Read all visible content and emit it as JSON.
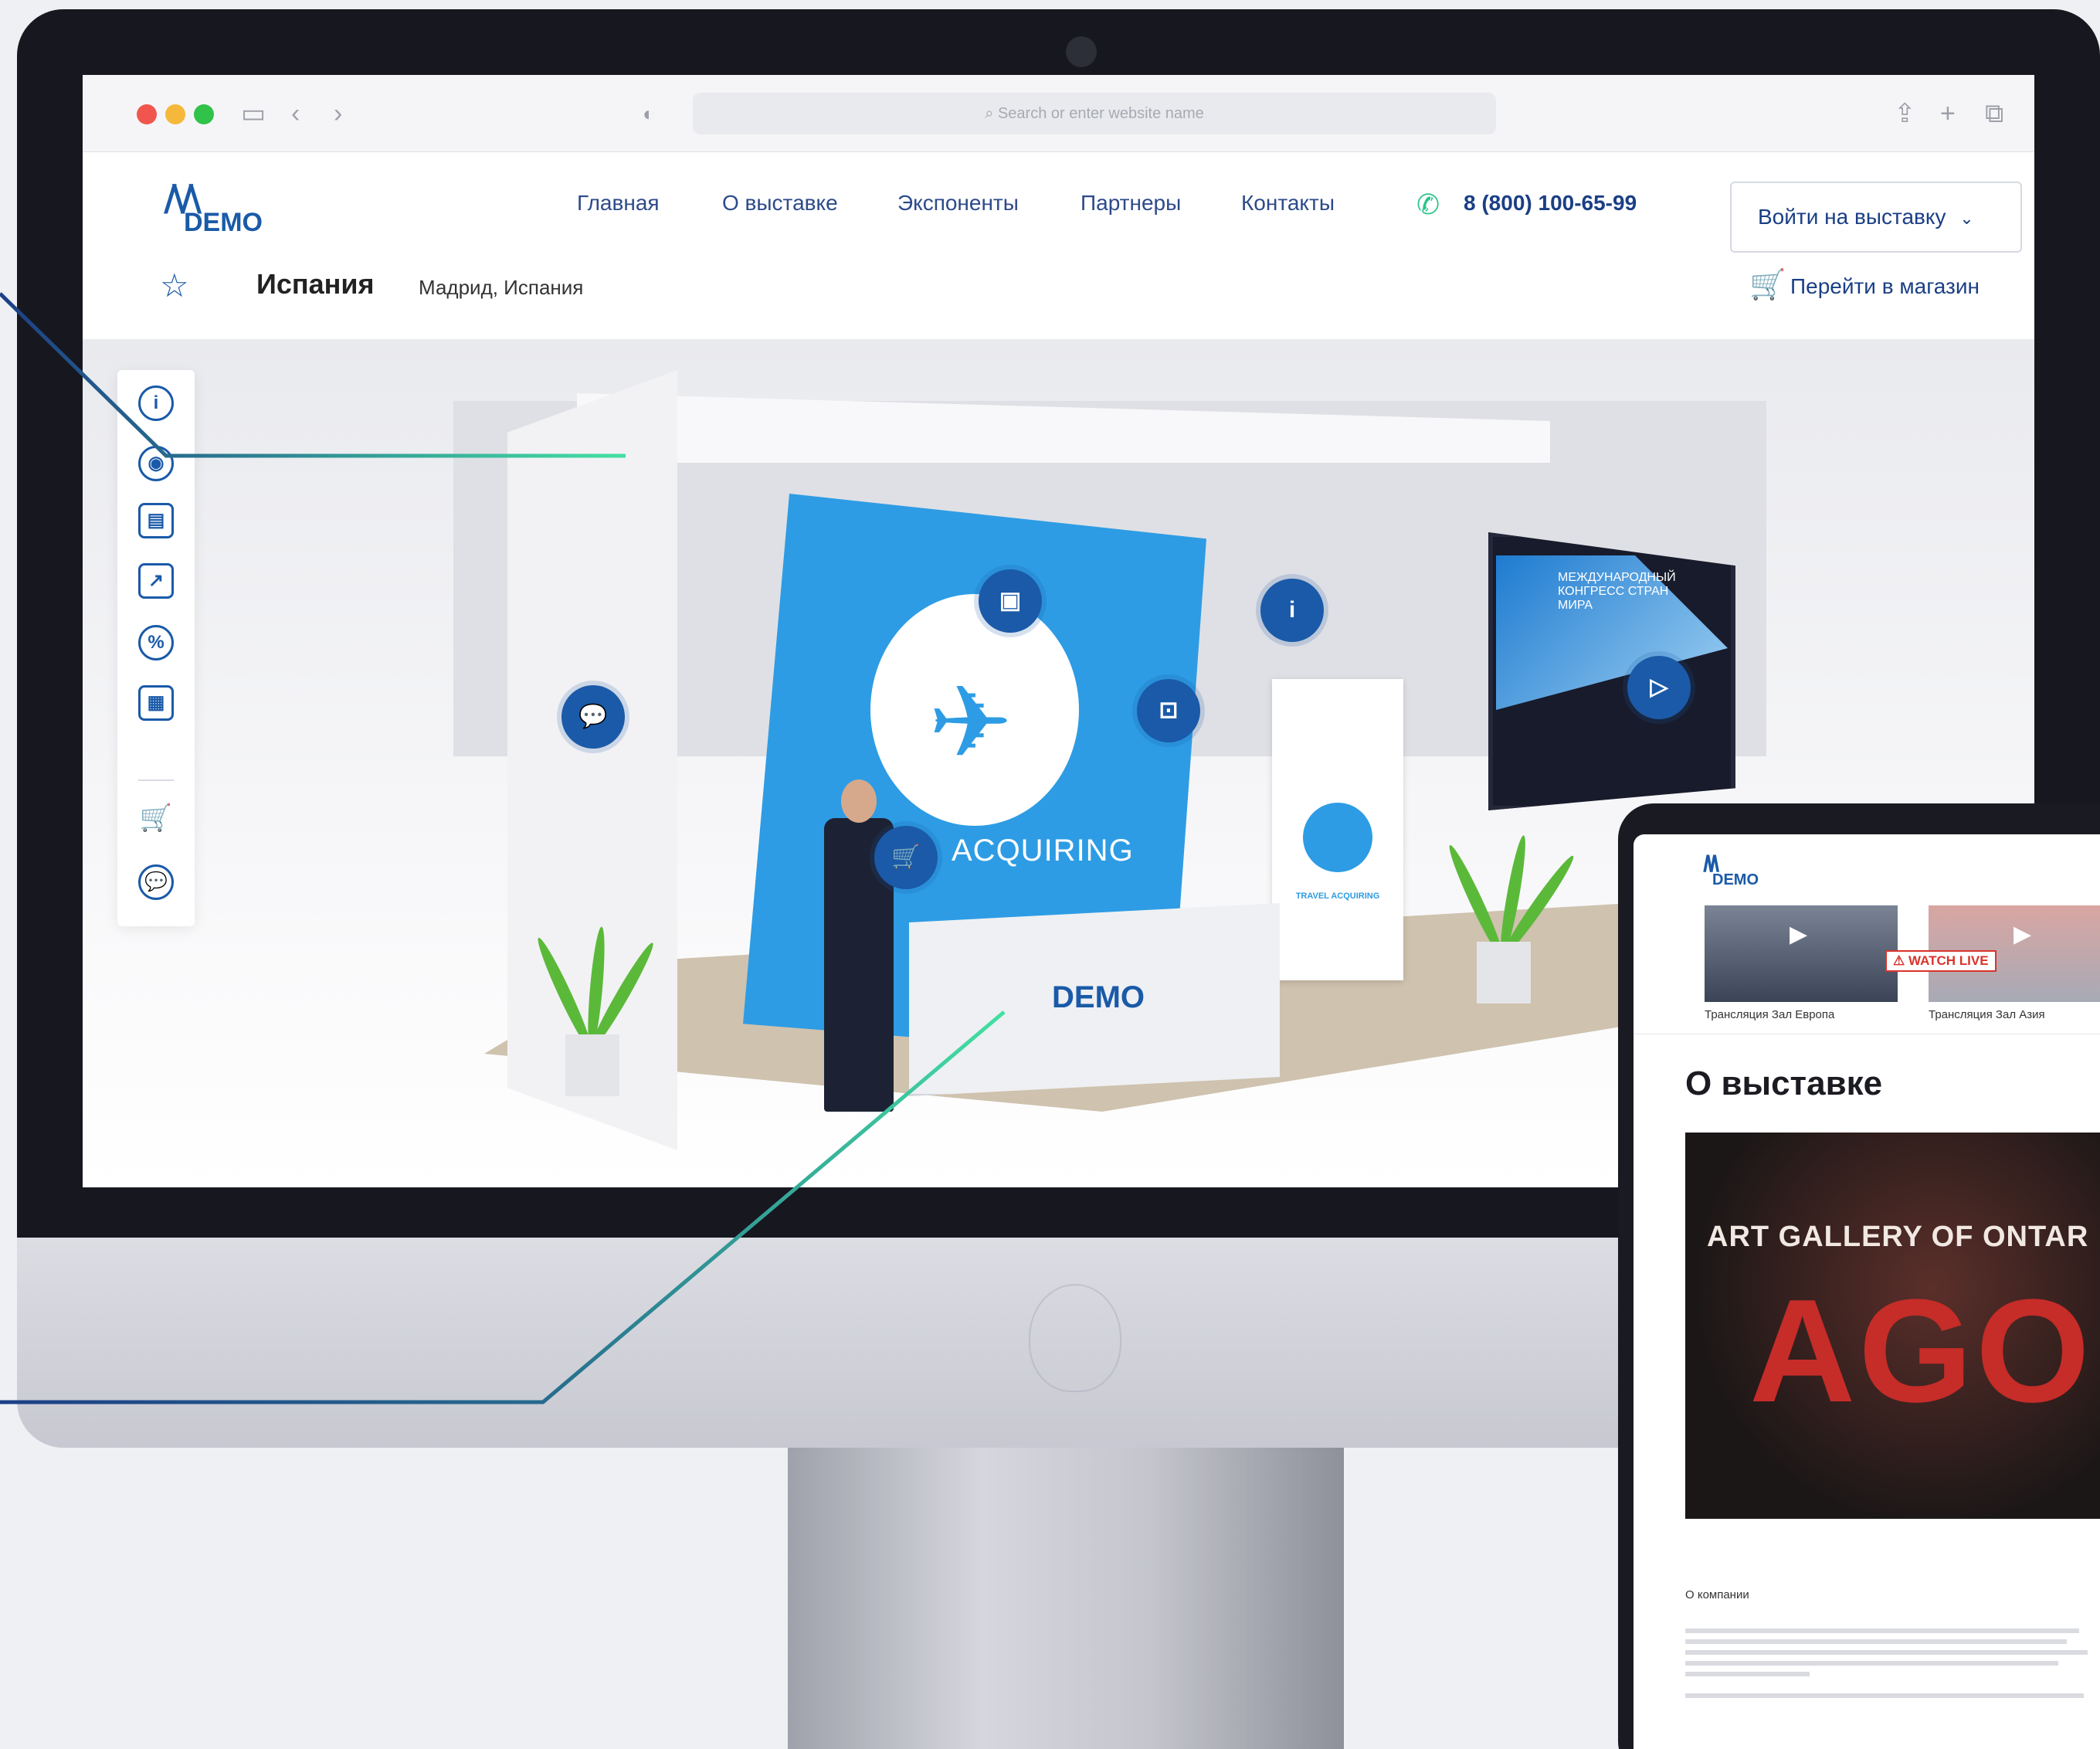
{
  "browser": {
    "address_placeholder": "Search or enter website name"
  },
  "header": {
    "logo_text": "DEMO",
    "nav": [
      "Главная",
      "О выставке",
      "Экспоненты",
      "Партнеры",
      "Контакты"
    ],
    "phone": "8 (800) 100-65-99",
    "login_button": "Войти на выставку"
  },
  "booth": {
    "title": "Испания",
    "location": "Мадрид, Испания",
    "shop_link": "Перейти в магазин"
  },
  "scene": {
    "banner_text": "ACQUIRING",
    "desk_logo": "DEMO",
    "rollup_text": "TRAVEL ACQUIRING",
    "tv_title": "МЕЖДУНАРОДНЫЙ КОНГРЕСС СТРАН МИРА"
  },
  "toolbar": {
    "items": [
      "info-icon",
      "webcam-icon",
      "archive-icon",
      "presentation-icon",
      "discount-icon",
      "video-screen-icon",
      "cart-icon",
      "chat-icon"
    ]
  },
  "hotspots": [
    "chat-icon",
    "video-screen-icon",
    "info-icon",
    "presentation-icon",
    "cart-icon",
    "play-icon"
  ],
  "tablet": {
    "logo_text": "DEMO",
    "videos": [
      {
        "caption": "Трансляция Зал Европа"
      },
      {
        "caption": "Трансляция Зал Азия",
        "badge": "WATCH LIVE"
      }
    ],
    "heading": "О выставке",
    "photo_sign": "ART GALLERY OF ONTAR",
    "photo_big_text": "AGO",
    "section_title": "О компании"
  },
  "colors": {
    "brand_blue": "#1a5aa8",
    "accent_green": "#2ec48a",
    "banner_blue": "#2d9ce4"
  }
}
